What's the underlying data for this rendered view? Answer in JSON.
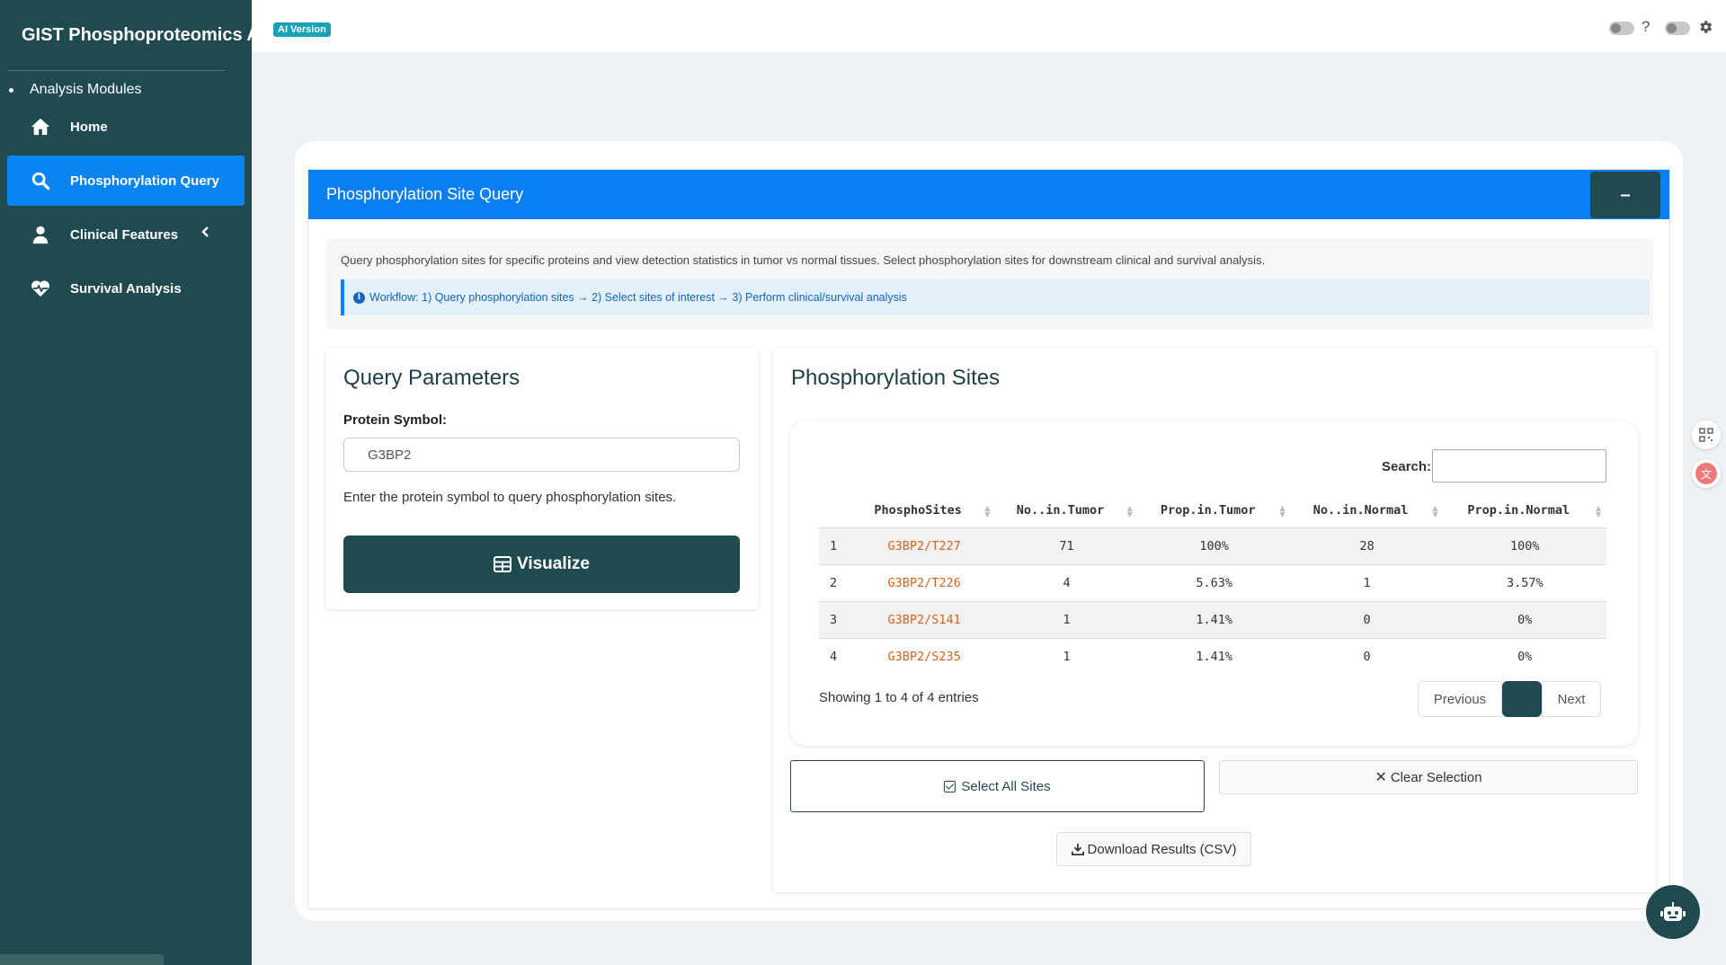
{
  "brand": {
    "title": "GIST Phosphoproteomics A"
  },
  "sidebar": {
    "section_label": "Analysis Modules",
    "items": [
      {
        "label": "Home",
        "icon": "home-icon",
        "active": false
      },
      {
        "label": "Phosphorylation Query",
        "icon": "search-icon",
        "active": true
      },
      {
        "label": "Clinical Features",
        "icon": "user-icon",
        "active": false
      },
      {
        "label": "Survival Analysis",
        "icon": "heartbeat-icon",
        "active": false
      }
    ]
  },
  "header": {
    "badge": "AI Version",
    "help": "?"
  },
  "box": {
    "title": "Phosphorylation Site Query",
    "collapse_label": "–",
    "description": "Query phosphorylation sites for specific proteins and view detection statistics in tumor vs normal tissues. Select phosphorylation sites for downstream clinical and survival analysis.",
    "workflow": "Workflow: 1) Query phosphorylation sites → 2) Select sites of interest → 3) Perform clinical/survival analysis"
  },
  "query": {
    "title": "Query Parameters",
    "label": "Protein Symbol:",
    "value": "G3BP2",
    "help": "Enter the protein symbol to query phosphorylation sites.",
    "button": "Visualize"
  },
  "sites": {
    "title": "Phosphorylation Sites",
    "search_label": "Search:",
    "columns": [
      "PhosphoSites",
      "No..in.Tumor",
      "Prop.in.Tumor",
      "No..in.Normal",
      "Prop.in.Normal"
    ],
    "rows": [
      {
        "idx": "1",
        "site": "G3BP2/T227",
        "n_tumor": "71",
        "p_tumor": "100%",
        "n_normal": "28",
        "p_normal": "100%"
      },
      {
        "idx": "2",
        "site": "G3BP2/T226",
        "n_tumor": "4",
        "p_tumor": "5.63%",
        "n_normal": "1",
        "p_normal": "3.57%"
      },
      {
        "idx": "3",
        "site": "G3BP2/S141",
        "n_tumor": "1",
        "p_tumor": "1.41%",
        "n_normal": "0",
        "p_normal": "0%"
      },
      {
        "idx": "4",
        "site": "G3BP2/S235",
        "n_tumor": "1",
        "p_tumor": "1.41%",
        "n_normal": "0",
        "p_normal": "0%"
      }
    ],
    "showing": "Showing 1 to 4 of 4 entries",
    "prev": "Previous",
    "next": "Next",
    "select_all": "Select All Sites",
    "clear": "Clear Selection",
    "download": "Download Results (CSV)"
  },
  "colors": {
    "sidebar": "#1f4a4f",
    "accent": "#0a7ff5",
    "site_link": "#d9631e"
  }
}
